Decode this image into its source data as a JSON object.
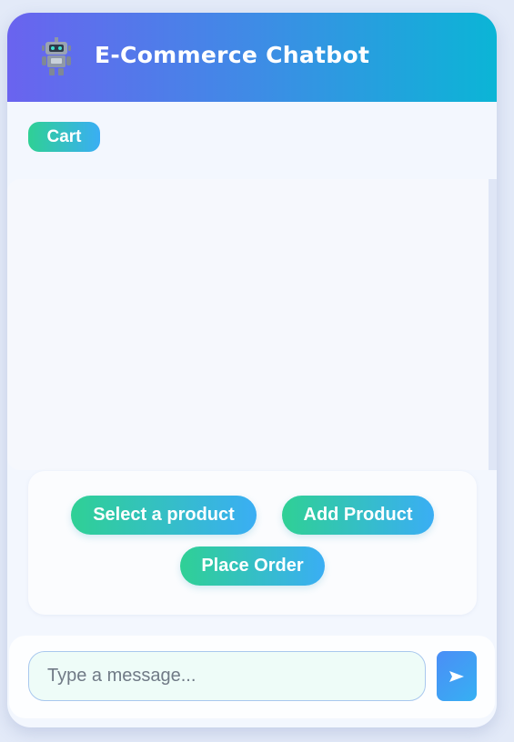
{
  "header": {
    "title": "E-Commerce Chatbot",
    "icon": "robot-icon"
  },
  "cart": {
    "label": "Cart"
  },
  "actions": {
    "select_product": "Select a product",
    "add_product": "Add Product",
    "place_order": "Place Order"
  },
  "composer": {
    "placeholder": "Type a message...",
    "send_icon": "send-arrow-icon"
  },
  "colors": {
    "header_gradient_start": "#6a63ef",
    "header_gradient_end": "#0bb5d6",
    "button_gradient_start": "#2fd095",
    "button_gradient_end": "#3aaef4"
  }
}
